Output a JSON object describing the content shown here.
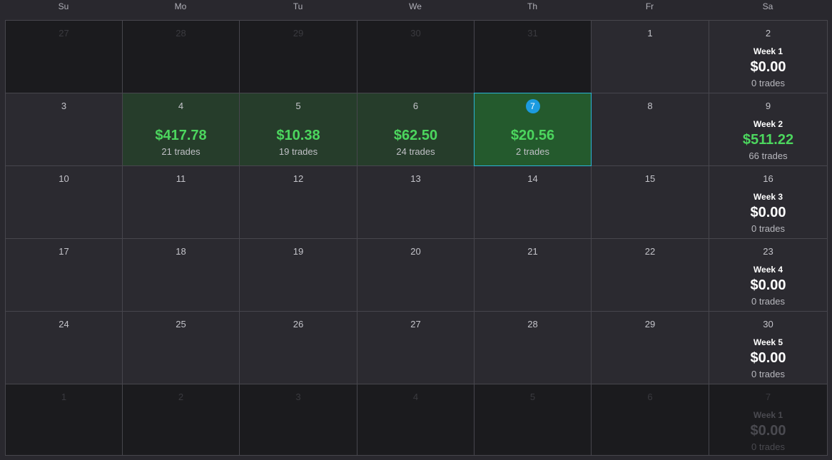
{
  "weekdays": [
    "Su",
    "Mo",
    "Tu",
    "We",
    "Th",
    "Fr",
    "Sa"
  ],
  "colors": {
    "profit": "#4cd65e",
    "today_badge": "#1c9be0",
    "today_border": "#29b5d8"
  },
  "weeks": [
    {
      "days": [
        {
          "num": "27",
          "other": true
        },
        {
          "num": "28",
          "other": true
        },
        {
          "num": "29",
          "other": true
        },
        {
          "num": "30",
          "other": true
        },
        {
          "num": "31",
          "other": true
        },
        {
          "num": "1"
        },
        {
          "num": "2"
        }
      ],
      "summary": {
        "label": "Week 1",
        "pnl": "$0.00",
        "trades": "0 trades"
      }
    },
    {
      "days": [
        {
          "num": "3"
        },
        {
          "num": "4",
          "pnl": "$417.78",
          "trades": "21 trades"
        },
        {
          "num": "5",
          "pnl": "$10.38",
          "trades": "19 trades"
        },
        {
          "num": "6",
          "pnl": "$62.50",
          "trades": "24 trades"
        },
        {
          "num": "7",
          "pnl": "$20.56",
          "trades": "2 trades",
          "today": true
        },
        {
          "num": "8"
        },
        {
          "num": "9"
        }
      ],
      "summary": {
        "label": "Week 2",
        "pnl": "$511.22",
        "trades": "66 trades",
        "positive": true
      }
    },
    {
      "days": [
        {
          "num": "10"
        },
        {
          "num": "11"
        },
        {
          "num": "12"
        },
        {
          "num": "13"
        },
        {
          "num": "14"
        },
        {
          "num": "15"
        },
        {
          "num": "16"
        }
      ],
      "summary": {
        "label": "Week 3",
        "pnl": "$0.00",
        "trades": "0 trades"
      }
    },
    {
      "days": [
        {
          "num": "17"
        },
        {
          "num": "18"
        },
        {
          "num": "19"
        },
        {
          "num": "20"
        },
        {
          "num": "21"
        },
        {
          "num": "22"
        },
        {
          "num": "23"
        }
      ],
      "summary": {
        "label": "Week 4",
        "pnl": "$0.00",
        "trades": "0 trades"
      }
    },
    {
      "days": [
        {
          "num": "24"
        },
        {
          "num": "25"
        },
        {
          "num": "26"
        },
        {
          "num": "27"
        },
        {
          "num": "28"
        },
        {
          "num": "29"
        },
        {
          "num": "30"
        }
      ],
      "summary": {
        "label": "Week 5",
        "pnl": "$0.00",
        "trades": "0 trades"
      }
    },
    {
      "days": [
        {
          "num": "1",
          "other": true
        },
        {
          "num": "2",
          "other": true
        },
        {
          "num": "3",
          "other": true
        },
        {
          "num": "4",
          "other": true
        },
        {
          "num": "5",
          "other": true
        },
        {
          "num": "6",
          "other": true
        },
        {
          "num": "7",
          "other": true
        }
      ],
      "summary": {
        "label": "Week 1",
        "pnl": "$0.00",
        "trades": "0 trades",
        "other": true
      }
    }
  ]
}
